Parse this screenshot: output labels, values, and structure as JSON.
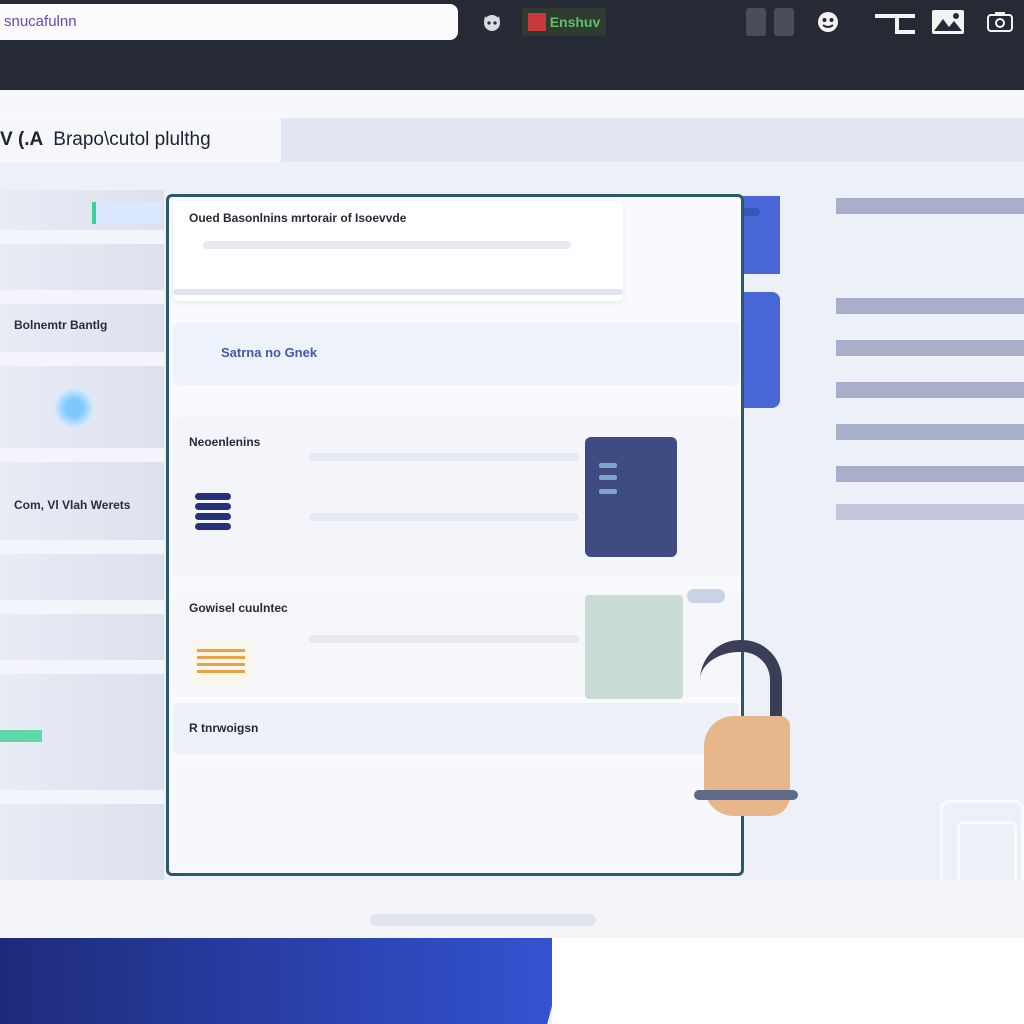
{
  "browser": {
    "address_text": "snucafulnn",
    "toolbar_tag_text": "Enshuv"
  },
  "header": {
    "prefix": "V (.A",
    "title": "Brapo\\cutol plulthg"
  },
  "sidebar": {
    "items": [
      {
        "label": "Bolnemtr Bantlg"
      },
      {
        "label": "Com, Vl Vlah Werets"
      }
    ]
  },
  "card": {
    "section_1_heading": "Oued Basonlnins mrtorair of Isoevvde",
    "section_2_link": "Satrna no Gnek",
    "section_3_heading": "Neoenlenins",
    "section_4_heading": "Gowisel cuulntec",
    "section_5_heading": "R tnrwoigsn"
  },
  "colors": {
    "topbar": "#262a34",
    "accent_blue": "#4966d6",
    "card_border": "#2a5a68",
    "link": "#4158b8"
  }
}
